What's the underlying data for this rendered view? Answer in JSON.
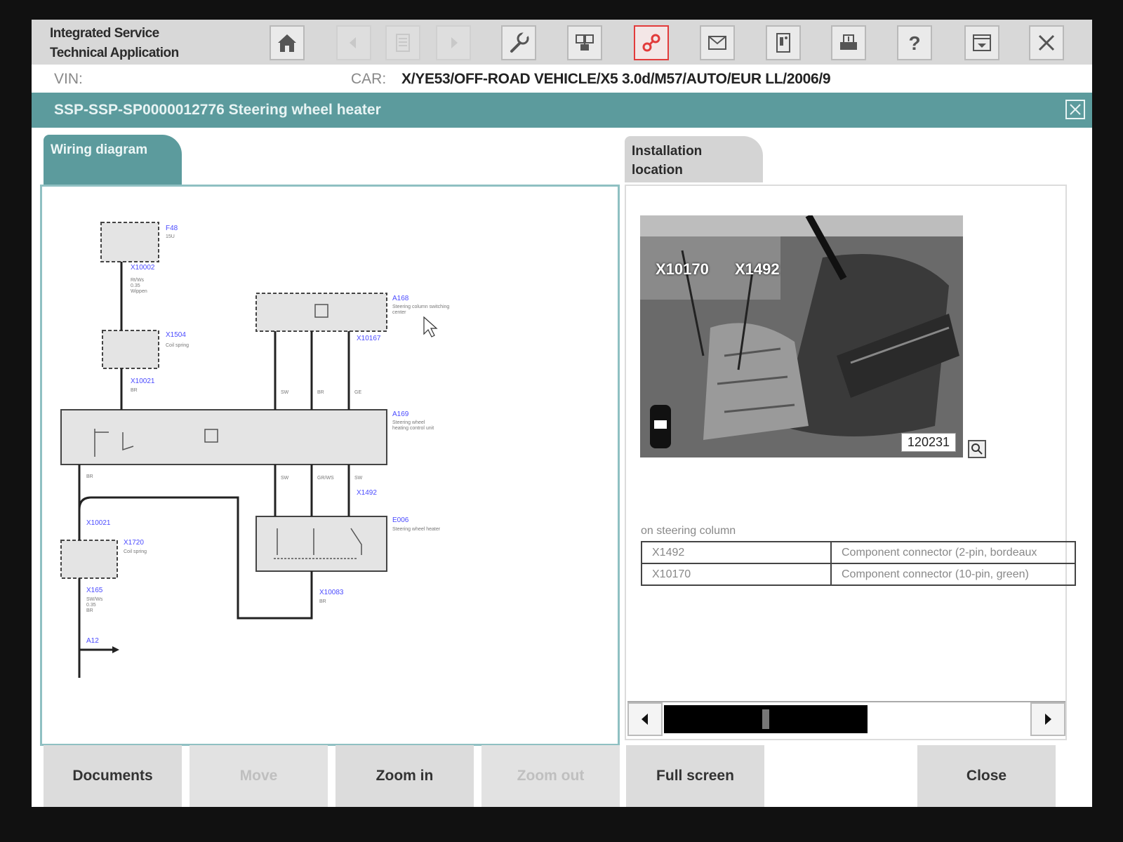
{
  "app": {
    "title_line1": "Integrated Service",
    "title_line2": "Technical Application"
  },
  "toolbar": {
    "buttons": [
      {
        "name": "home",
        "icon": "home-icon"
      },
      {
        "name": "back",
        "icon": "arrow-left-icon",
        "disabled": true
      },
      {
        "name": "document",
        "icon": "document-icon",
        "disabled": true
      },
      {
        "name": "forward",
        "icon": "arrow-right-icon",
        "disabled": true
      },
      {
        "name": "service",
        "icon": "wrench-icon"
      },
      {
        "name": "diagnosis",
        "icon": "diagnosis-icon"
      },
      {
        "name": "connection",
        "icon": "link-icon",
        "active": true
      },
      {
        "name": "messages",
        "icon": "envelope-icon"
      },
      {
        "name": "vehicle-info",
        "icon": "info-card-icon"
      },
      {
        "name": "print",
        "icon": "printer-icon"
      },
      {
        "name": "help",
        "icon": "question-icon"
      },
      {
        "name": "minimize",
        "icon": "minimize-icon"
      },
      {
        "name": "exit",
        "icon": "close-icon"
      }
    ]
  },
  "vin": {
    "label": "VIN:",
    "car_label": "CAR:",
    "car_value": "X/YE53/OFF-ROAD VEHICLE/X5 3.0d/M57/AUTO/EUR LL/2006/9"
  },
  "document": {
    "title": "SSP-SSP-SP0000012776 Steering wheel heater"
  },
  "tabs": {
    "wiring": "Wiring diagram",
    "install_line1": "Installation",
    "install_line2": "location"
  },
  "photo": {
    "label_a": "X10170",
    "label_b": "X1492",
    "image_id": "120231"
  },
  "location": {
    "caption": "on steering column",
    "rows": [
      {
        "id": "X1492",
        "desc": "Component connector (2-pin, bordeaux"
      },
      {
        "id": "X10170",
        "desc": "Component connector (10-pin, green)"
      }
    ]
  },
  "bottom_buttons": {
    "documents": "Documents",
    "move": "Move",
    "zoom_in": "Zoom in",
    "zoom_out": "Zoom out",
    "full_screen": "Full screen",
    "close": "Close"
  },
  "colors": {
    "accent_teal": "#5c9b9d",
    "active_red": "#e23b3b",
    "link_blue": "#3b3bff"
  }
}
